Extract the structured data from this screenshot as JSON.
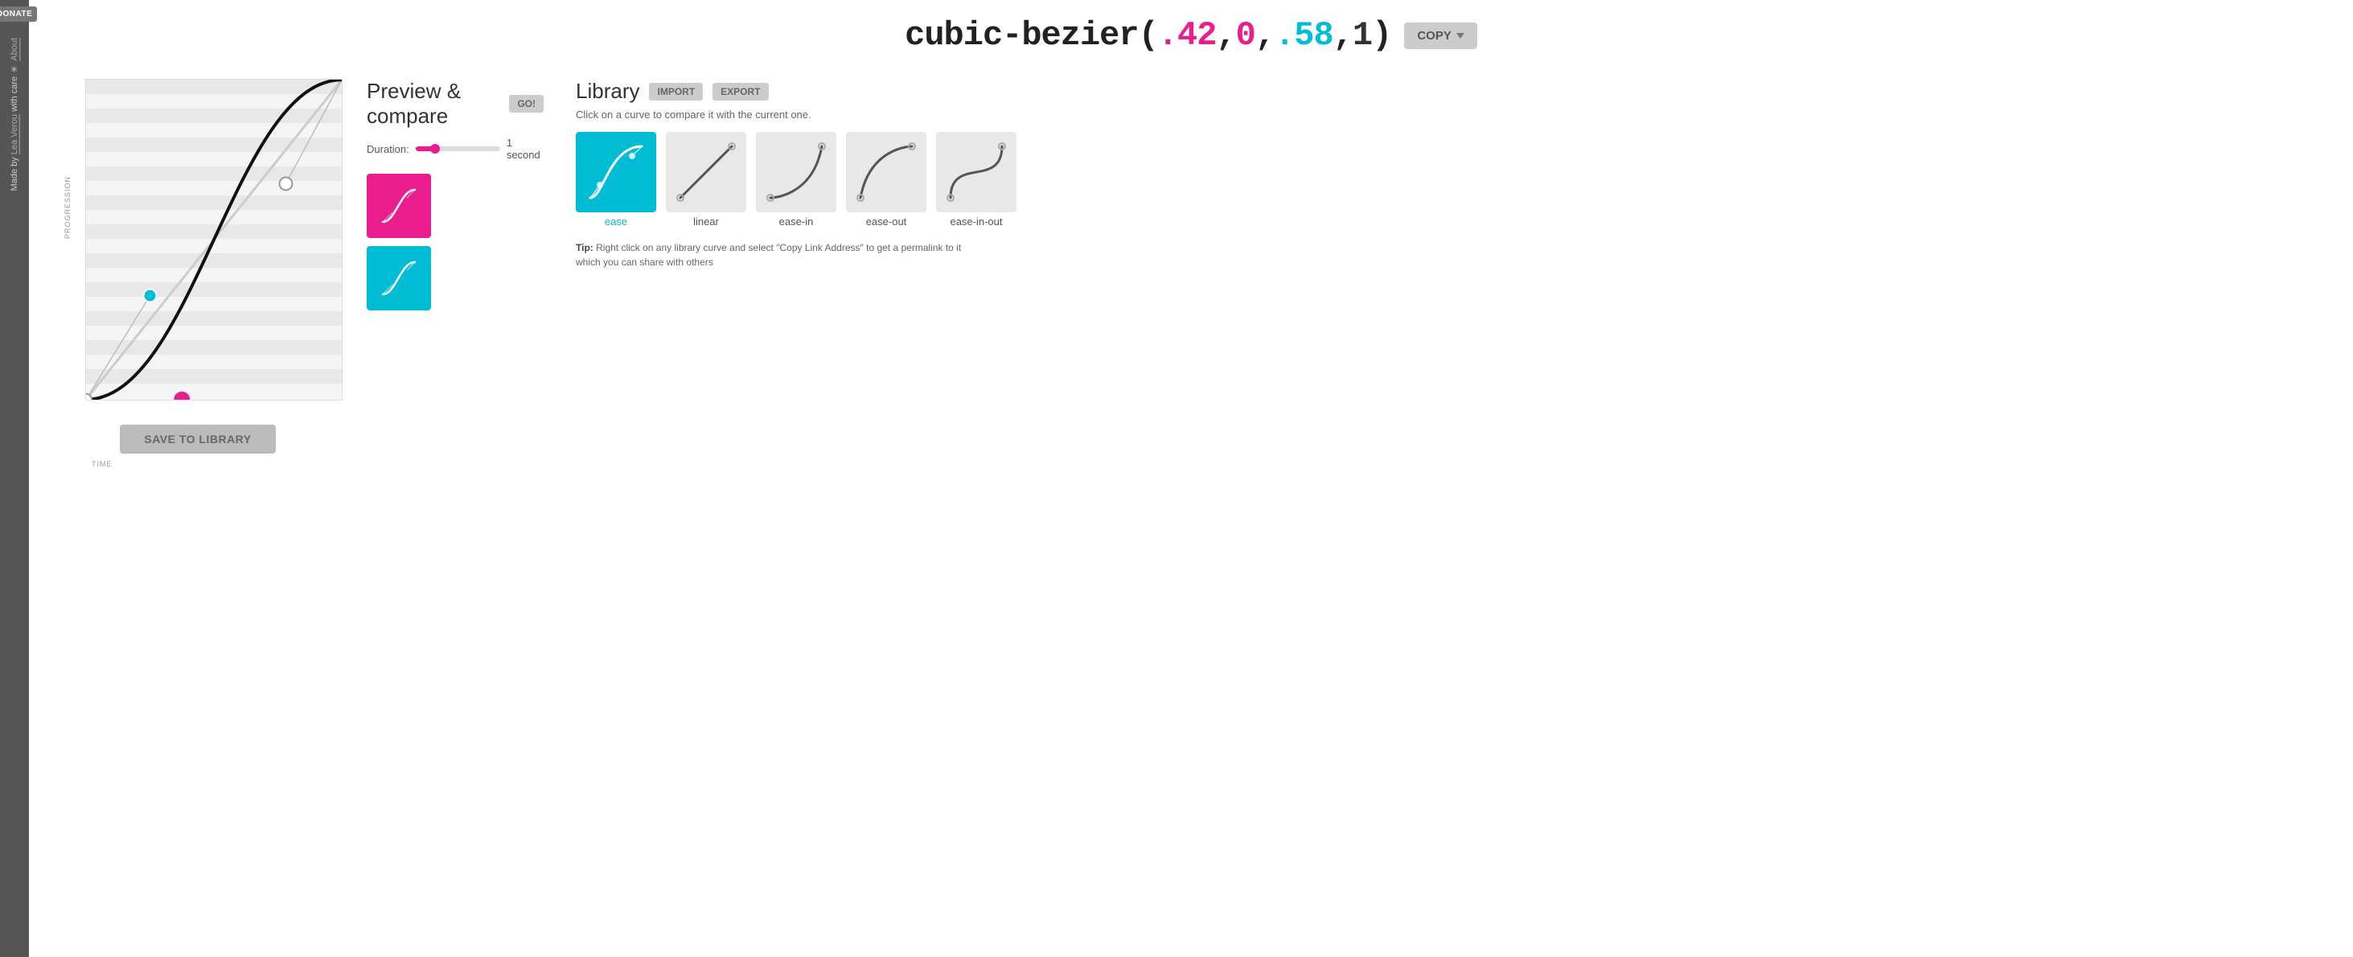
{
  "sidebar": {
    "donate_label": "DONATE",
    "made_by_text": "Made by",
    "author": "Lea Verou",
    "with_care": "with care",
    "asterisk": "✳",
    "about": "About"
  },
  "header": {
    "title_prefix": "cubic-bezier(",
    "val1": ".42",
    "comma1": ",",
    "val2": "0",
    "comma2": ",",
    "val3": ".58",
    "comma3": ",",
    "val4": "1",
    "title_suffix": ")",
    "copy_label": "COPY"
  },
  "preview": {
    "title": "Preview & compare",
    "go_label": "GO!",
    "duration_label": "Duration:",
    "duration_value": "1 second"
  },
  "library": {
    "title": "Library",
    "import_label": "IMPORT",
    "export_label": "EXPORT",
    "subtitle": "Click on a curve to compare it with the current one.",
    "items": [
      {
        "id": "ease",
        "label": "ease",
        "active": true
      },
      {
        "id": "linear",
        "label": "linear",
        "active": false
      },
      {
        "id": "ease-in",
        "label": "ease-in",
        "active": false
      },
      {
        "id": "ease-out",
        "label": "ease-out",
        "active": false
      },
      {
        "id": "ease-in-out",
        "label": "ease-in-out",
        "active": false
      }
    ],
    "tip_prefix": "Tip:",
    "tip_text": " Right click on any library curve and select \"Copy Link Address\" to get a permalink to it which you can share with others"
  },
  "canvas": {
    "progression_label": "PROGRESSION",
    "time_label": "TIME"
  },
  "save_button": "SAVE TO LIBRARY"
}
